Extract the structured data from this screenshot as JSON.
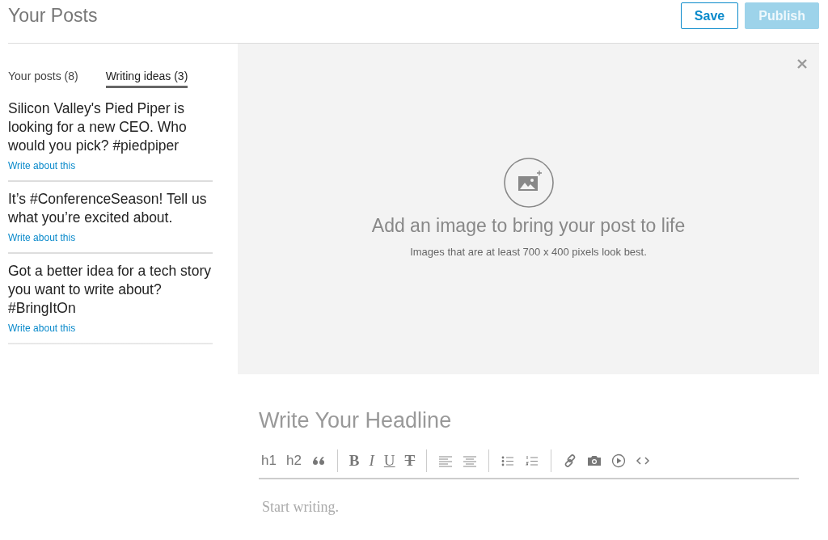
{
  "header": {
    "title": "Your Posts",
    "buttons": [
      {
        "label": "Save",
        "kind": "outline",
        "disabled": false
      },
      {
        "label": "Publish",
        "kind": "primary",
        "disabled": true
      }
    ]
  },
  "tabs": [
    {
      "label": "Your posts (8)",
      "selected": false
    },
    {
      "label": "Writing ideas (3)",
      "selected": true
    }
  ],
  "ideas": [
    {
      "text": "Silicon Valley's Pied Piper is looking for a new CEO. Who would you pick? #piedpiper",
      "link": "Write about this"
    },
    {
      "text": "It’s #ConferenceSeason! Tell us what you’re excited about.",
      "link": "Write about this"
    },
    {
      "text": "Got a better idea for a tech story you want to write about? #BringItOn",
      "link": "Write about this"
    }
  ],
  "image_panel": {
    "title": "Add an image to bring your post to life",
    "hint": "Images that are at least 700 x 400 pixels look best."
  },
  "editor": {
    "headline_placeholder": "Write Your Headline",
    "body_placeholder": "Start writing.",
    "toolbar": [
      [
        {
          "kind": "text",
          "label": "h1"
        },
        {
          "kind": "text",
          "label": "h2"
        },
        {
          "kind": "quote"
        }
      ],
      [
        {
          "kind": "bold",
          "label": "B"
        },
        {
          "kind": "italic",
          "label": "I"
        },
        {
          "kind": "underline",
          "label": "U"
        },
        {
          "kind": "strike",
          "label": "T"
        }
      ],
      [
        {
          "kind": "align-left"
        },
        {
          "kind": "align-center"
        }
      ],
      [
        {
          "kind": "bullets"
        },
        {
          "kind": "numbers"
        }
      ],
      [
        {
          "kind": "link"
        },
        {
          "kind": "camera"
        },
        {
          "kind": "play"
        },
        {
          "kind": "code"
        }
      ]
    ]
  }
}
